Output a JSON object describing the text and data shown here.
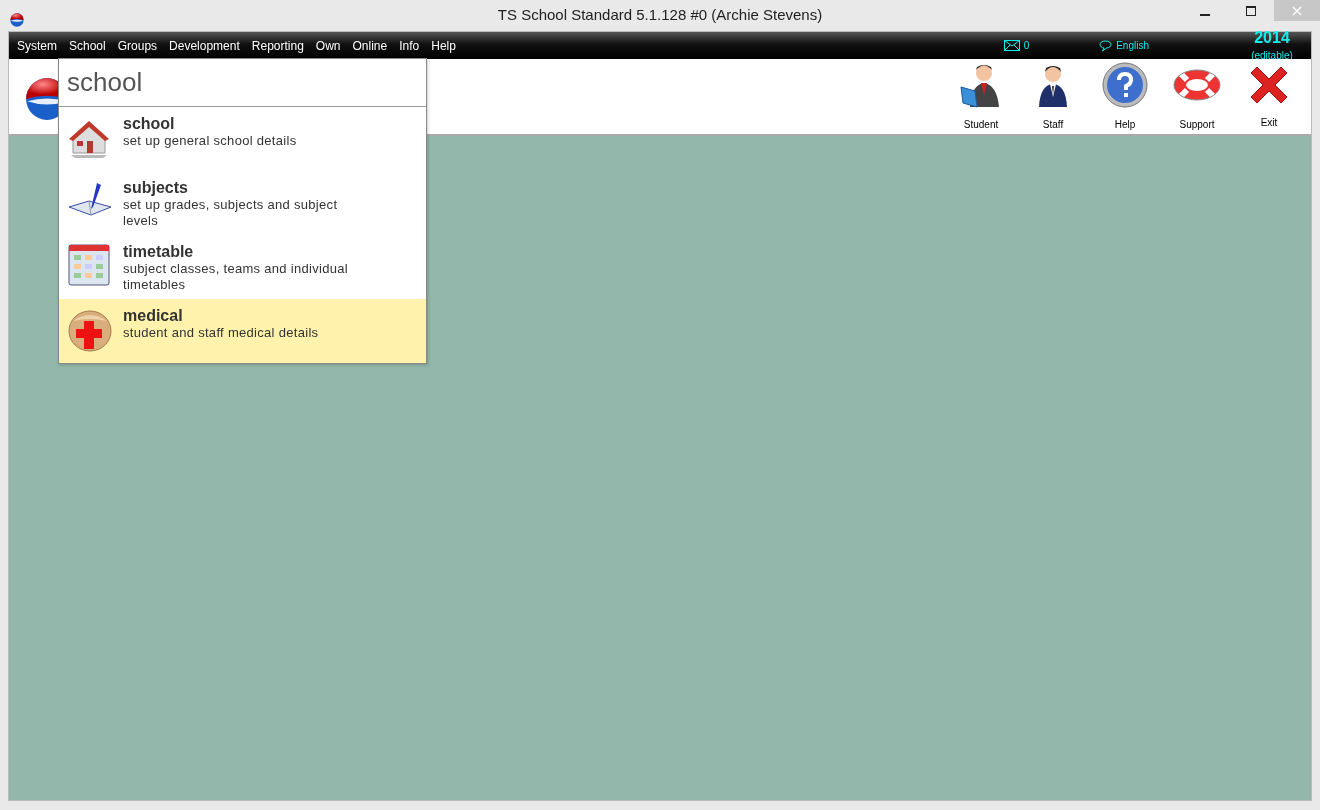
{
  "window": {
    "title": "TS School Standard 5.1.128 #0 (Archie Stevens)"
  },
  "menu": [
    "System",
    "School",
    "Groups",
    "Development",
    "Reporting",
    "Own",
    "Online",
    "Info",
    "Help"
  ],
  "status": {
    "messages": "0",
    "language": "English",
    "year": "2014",
    "year_note": "(editable)"
  },
  "toolbar": [
    {
      "kind": "student",
      "label": "Student"
    },
    {
      "kind": "staff",
      "label": "Staff"
    },
    {
      "kind": "help",
      "label": "Help"
    },
    {
      "kind": "support",
      "label": "Support"
    },
    {
      "kind": "exit",
      "label": "Exit"
    }
  ],
  "search": {
    "value": "school"
  },
  "results": [
    {
      "kind": "school",
      "title": "school",
      "description": "set up general school details",
      "selected": false
    },
    {
      "kind": "subjects",
      "title": "subjects",
      "description": "set up grades, subjects and subject levels",
      "selected": false
    },
    {
      "kind": "timetable",
      "title": "timetable",
      "description": "subject classes, teams and individual timetables",
      "selected": false
    },
    {
      "kind": "medical",
      "title": "medical",
      "description": "student and staff medical details",
      "selected": true
    }
  ]
}
